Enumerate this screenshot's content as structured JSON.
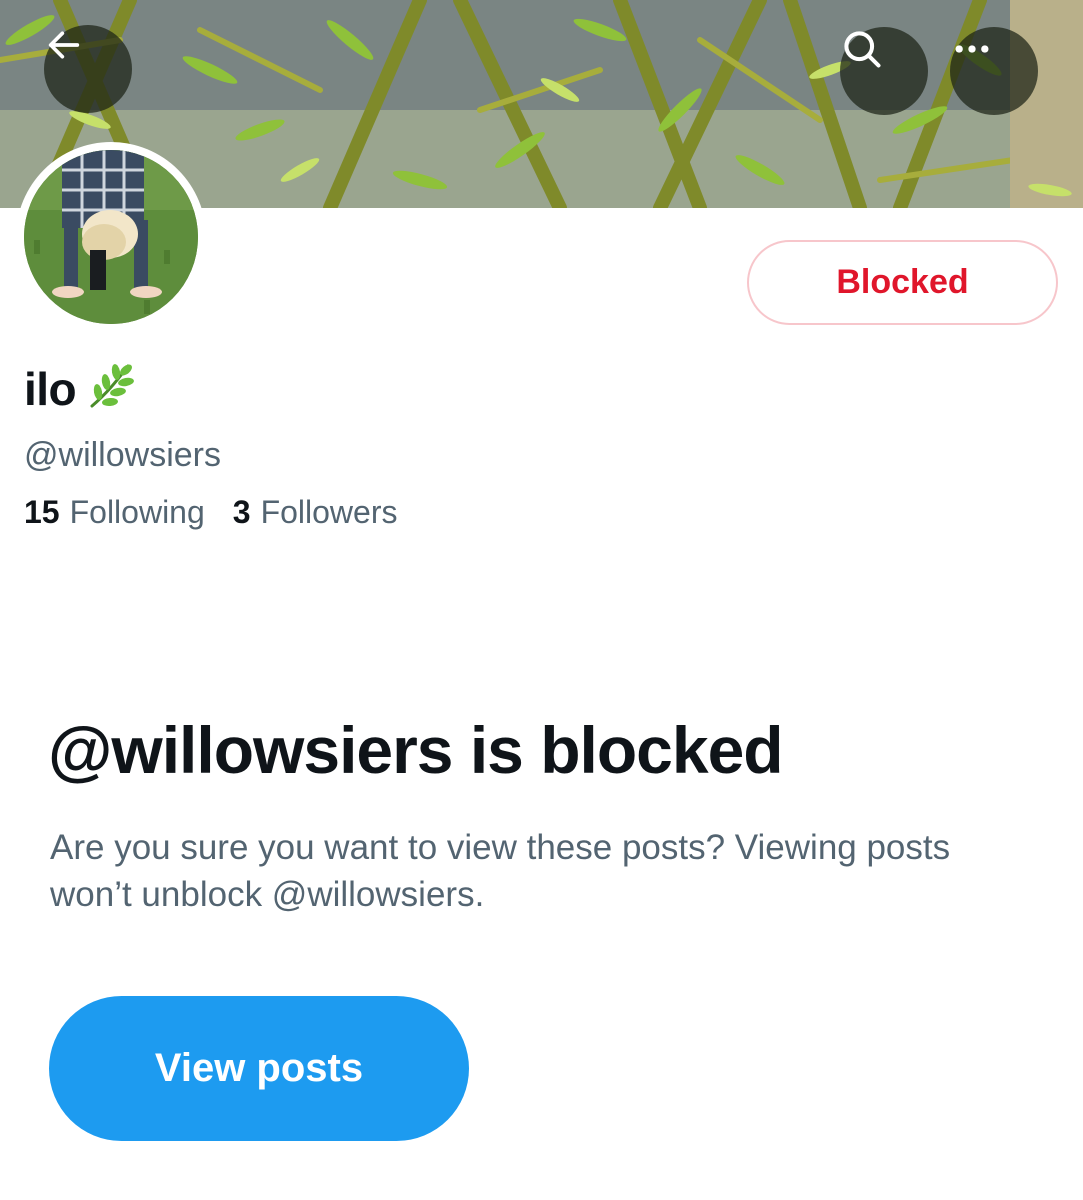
{
  "header": {
    "back_icon": "arrow-left-icon",
    "search_icon": "search-icon",
    "more_icon": "more-horizontal-icon"
  },
  "profile": {
    "display_name": "ilo",
    "name_emoji_icon": "herb-leaf-icon",
    "handle": "@willowsiers",
    "following_count": "15",
    "following_label": "Following",
    "followers_count": "3",
    "followers_label": "Followers",
    "blocked_label": "Blocked"
  },
  "blocked_notice": {
    "title": "@willowsiers is blocked",
    "description": "Are you sure you want to view these posts? Viewing posts won’t unblock @willowsiers.",
    "view_posts_label": "View posts"
  },
  "colors": {
    "accent_blue": "#1d9bf0",
    "blocked_red": "#e0162b",
    "blocked_border": "#f7c6cb",
    "text_primary": "#0f1419",
    "text_secondary": "#536471"
  }
}
